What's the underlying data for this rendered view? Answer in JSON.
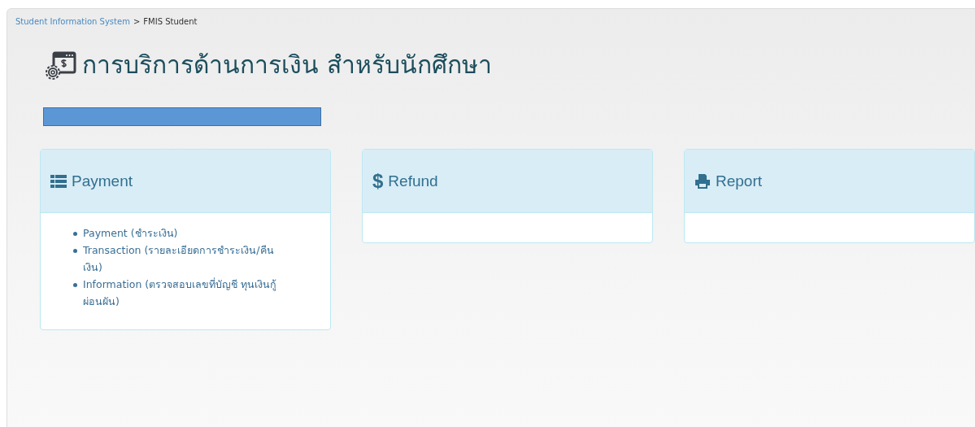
{
  "breadcrumb": {
    "link": "Student Information System",
    "separator": ">",
    "current": "FMIS Student"
  },
  "title": "การบริการด้านการเงิน สำหรับนักศึกษา",
  "panels": [
    {
      "kind": "list",
      "title": "Payment",
      "links": [
        "Payment (ชำระเงิน)",
        "Transaction (รายละเอียดการชำระเงิน/คืนเงิน)",
        "Information (ตรวจสอบเลขที่บัญชี ทุนเงินกู้ ผ่อนผัน)"
      ]
    },
    {
      "kind": "dollar",
      "icon_char": "$",
      "title": "Refund"
    },
    {
      "kind": "printer",
      "title": "Report"
    }
  ]
}
